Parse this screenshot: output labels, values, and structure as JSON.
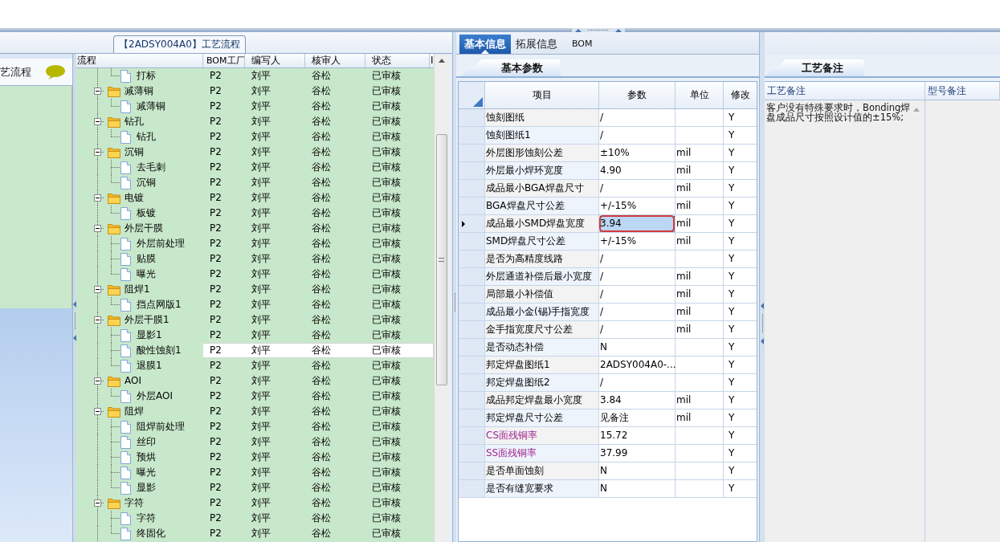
{
  "left_panel": {
    "title": "【2ADSY004A0】工艺流程"
  },
  "sidebar": {
    "items": [
      {
        "label": "艺流程"
      }
    ]
  },
  "tree": {
    "columns": [
      "流程",
      "BOM工厂",
      "编写人",
      "核审人",
      "状态",
      "I"
    ],
    "rows": [
      {
        "children": [
          {
            "name": "打标",
            "bom": "P2",
            "writer": "刘平",
            "reviewer": "谷松",
            "status": "已审核",
            "selected": false
          }
        ]
      },
      {
        "name": "减薄铜",
        "bom": "P2",
        "writer": "刘平",
        "reviewer": "谷松",
        "status": "已审核",
        "selected": false,
        "expanded": true,
        "children": [
          {
            "name": "减薄铜",
            "bom": "P2",
            "writer": "刘平",
            "reviewer": "谷松",
            "status": "已审核",
            "selected": false
          }
        ]
      },
      {
        "name": "钻孔",
        "bom": "P2",
        "writer": "刘平",
        "reviewer": "谷松",
        "status": "已审核",
        "selected": false,
        "expanded": true,
        "children": [
          {
            "name": "钻孔",
            "bom": "P2",
            "writer": "刘平",
            "reviewer": "谷松",
            "status": "已审核",
            "selected": false
          }
        ]
      },
      {
        "name": "沉铜",
        "bom": "P2",
        "writer": "刘平",
        "reviewer": "谷松",
        "status": "已审核",
        "selected": false,
        "expanded": true,
        "children": [
          {
            "name": "去毛刺",
            "bom": "P2",
            "writer": "刘平",
            "reviewer": "谷松",
            "status": "已审核",
            "selected": false
          },
          {
            "name": "沉铜",
            "bom": "P2",
            "writer": "刘平",
            "reviewer": "谷松",
            "status": "已审核",
            "selected": false
          }
        ]
      },
      {
        "name": "电镀",
        "bom": "P2",
        "writer": "刘平",
        "reviewer": "谷松",
        "status": "已审核",
        "selected": false,
        "expanded": true,
        "children": [
          {
            "name": "板镀",
            "bom": "P2",
            "writer": "刘平",
            "reviewer": "谷松",
            "status": "已审核",
            "selected": false
          }
        ]
      },
      {
        "name": "外层干膜",
        "bom": "P2",
        "writer": "刘平",
        "reviewer": "谷松",
        "status": "已审核",
        "selected": false,
        "expanded": true,
        "children": [
          {
            "name": "外层前处理",
            "bom": "P2",
            "writer": "刘平",
            "reviewer": "谷松",
            "status": "已审核",
            "selected": false
          },
          {
            "name": "贴膜",
            "bom": "P2",
            "writer": "刘平",
            "reviewer": "谷松",
            "status": "已审核",
            "selected": false
          },
          {
            "name": "曝光",
            "bom": "P2",
            "writer": "刘平",
            "reviewer": "谷松",
            "status": "已审核",
            "selected": false
          }
        ]
      },
      {
        "name": "阻焊1",
        "bom": "P2",
        "writer": "刘平",
        "reviewer": "谷松",
        "status": "已审核",
        "selected": false,
        "expanded": true,
        "children": [
          {
            "name": "挡点网版1",
            "bom": "P2",
            "writer": "刘平",
            "reviewer": "谷松",
            "status": "已审核",
            "selected": false
          }
        ]
      },
      {
        "name": "外层干膜1",
        "bom": "P2",
        "writer": "刘平",
        "reviewer": "谷松",
        "status": "已审核",
        "selected": false,
        "expanded": true,
        "children": [
          {
            "name": "显影1",
            "bom": "P2",
            "writer": "刘平",
            "reviewer": "谷松",
            "status": "已审核",
            "selected": false
          },
          {
            "name": "酸性蚀刻1",
            "bom": "P2",
            "writer": "刘平",
            "reviewer": "谷松",
            "status": "已审核",
            "selected": true
          },
          {
            "name": "退膜1",
            "bom": "P2",
            "writer": "刘平",
            "reviewer": "谷松",
            "status": "已审核",
            "selected": false
          }
        ]
      },
      {
        "name": "AOI",
        "bom": "P2",
        "writer": "刘平",
        "reviewer": "谷松",
        "status": "已审核",
        "selected": false,
        "expanded": true,
        "children": [
          {
            "name": "外层AOI",
            "bom": "P2",
            "writer": "刘平",
            "reviewer": "谷松",
            "status": "已审核",
            "selected": false
          }
        ]
      },
      {
        "name": "阻焊",
        "bom": "P2",
        "writer": "刘平",
        "reviewer": "谷松",
        "status": "已审核",
        "selected": false,
        "expanded": true,
        "children": [
          {
            "name": "阻焊前处理",
            "bom": "P2",
            "writer": "刘平",
            "reviewer": "谷松",
            "status": "已审核",
            "selected": false
          },
          {
            "name": "丝印",
            "bom": "P2",
            "writer": "刘平",
            "reviewer": "谷松",
            "status": "已审核",
            "selected": false
          },
          {
            "name": "预烘",
            "bom": "P2",
            "writer": "刘平",
            "reviewer": "谷松",
            "status": "已审核",
            "selected": false
          },
          {
            "name": "曝光",
            "bom": "P2",
            "writer": "刘平",
            "reviewer": "谷松",
            "status": "已审核",
            "selected": false
          },
          {
            "name": "显影",
            "bom": "P2",
            "writer": "刘平",
            "reviewer": "谷松",
            "status": "已审核",
            "selected": false
          }
        ]
      },
      {
        "name": "字符",
        "bom": "P2",
        "writer": "刘平",
        "reviewer": "谷松",
        "status": "已审核",
        "selected": false,
        "expanded": true,
        "children": [
          {
            "name": "字符",
            "bom": "P2",
            "writer": "刘平",
            "reviewer": "谷松",
            "status": "已审核",
            "selected": false
          },
          {
            "name": "终固化",
            "bom": "P2",
            "writer": "刘平",
            "reviewer": "谷松",
            "status": "已审核",
            "selected": false
          }
        ]
      }
    ]
  },
  "params": {
    "tabs": [
      {
        "label": "基本信息",
        "selected": true
      },
      {
        "label": "拓展信息",
        "selected": false
      },
      {
        "label": "BOM",
        "selected": false
      }
    ],
    "subtab": "基本参数",
    "columns": [
      "项目",
      "参数",
      "单位",
      "修改"
    ],
    "rows": [
      {
        "item": "蚀刻图纸",
        "value": "/",
        "modified": "Y",
        "selected": false
      },
      {
        "item": "蚀刻图纸1",
        "value": "/",
        "modified": "Y",
        "selected": false
      },
      {
        "item": "外层图形蚀刻公差",
        "value": "±10%",
        "unit": "mil",
        "modified": "Y",
        "selected": false
      },
      {
        "item": "外层最小焊环宽度",
        "value": "4.90",
        "unit": "mil",
        "modified": "Y",
        "selected": false
      },
      {
        "item": "成品最小BGA焊盘尺寸",
        "value": "/",
        "unit": "mil",
        "modified": "Y",
        "selected": false
      },
      {
        "item": "BGA焊盘尺寸公差",
        "value": "+/-15%",
        "unit": "mil",
        "modified": "Y",
        "selected": false
      },
      {
        "item": "成品最小SMD焊盘宽度",
        "value": "3.94",
        "unit": "mil",
        "modified": "Y",
        "selected": true,
        "circled": true
      },
      {
        "item": "SMD焊盘尺寸公差",
        "value": "+/-15%",
        "unit": "mil",
        "modified": "Y",
        "selected": false
      },
      {
        "item": "是否为高精度线路",
        "value": "/",
        "modified": "Y",
        "selected": false
      },
      {
        "item": "外层通道补偿后最小宽度",
        "value": "/",
        "unit": "mil",
        "modified": "Y",
        "selected": false
      },
      {
        "item": "局部最小补偿值",
        "value": "/",
        "unit": "mil",
        "modified": "Y",
        "selected": false
      },
      {
        "item": "成品最小金(锡)手指宽度",
        "value": "/",
        "unit": "mil",
        "modified": "Y",
        "selected": false
      },
      {
        "item": "金手指宽度尺寸公差",
        "value": "/",
        "unit": "mil",
        "modified": "Y",
        "selected": false
      },
      {
        "item": "是否动态补偿",
        "value": "N",
        "modified": "Y",
        "selected": false
      },
      {
        "item": "邦定焊盘图纸1",
        "value": "2ADSY004A0-...",
        "modified": "Y",
        "selected": false
      },
      {
        "item": "邦定焊盘图纸2",
        "value": "/",
        "modified": "Y",
        "selected": false
      },
      {
        "item": "成品邦定焊盘最小宽度",
        "value": "3.84",
        "unit": "mil",
        "modified": "Y",
        "selected": false
      },
      {
        "item": "邦定焊盘尺寸公差",
        "value": "见备注",
        "unit": "mil",
        "modified": "Y",
        "selected": false
      },
      {
        "item": "CS面残铜率",
        "value": "15.72",
        "modified": "Y",
        "color": "#a0258f",
        "selected": false
      },
      {
        "item": "SS面残铜率",
        "value": "37.99",
        "modified": "Y",
        "color": "#a0258f",
        "selected": false
      },
      {
        "item": "是否单面蚀刻",
        "value": "N",
        "modified": "Y",
        "selected": false
      },
      {
        "item": "是否有缝宽要求",
        "value": "N",
        "modified": "Y",
        "selected": false
      }
    ]
  },
  "remarks": {
    "subtab": "工艺备注",
    "columns": [
      "工艺备注",
      "型号备注"
    ],
    "note": "客户没有特殊要求时，Bonding焊盘成品尺寸按照设计值的±15%;"
  }
}
